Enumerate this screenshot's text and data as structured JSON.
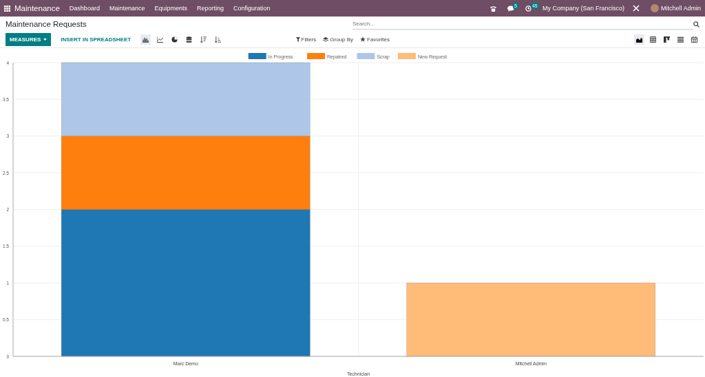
{
  "navbar": {
    "app_name": "Maintenance",
    "menu": [
      "Dashboard",
      "Maintenance",
      "Equipments",
      "Reporting",
      "Configuration"
    ],
    "messages_badge": "5",
    "activities_badge": "45",
    "company": "My Company (San Francisco)",
    "user": "Mitchell Admin"
  },
  "control_panel": {
    "title": "Maintenance Requests",
    "measures_button": "MEASURES",
    "insert_button": "INSERT IN SPREADSHEET",
    "search": {
      "placeholder": "Search..."
    },
    "filters": "Filters",
    "group_by": "Group By",
    "favorites": "Favorites",
    "chart_types": [
      {
        "kind": "bar",
        "selected": true
      },
      {
        "kind": "line",
        "selected": false
      },
      {
        "kind": "pie",
        "selected": false
      }
    ],
    "views": [
      {
        "kind": "graph",
        "selected": true
      },
      {
        "kind": "pivot",
        "selected": false
      },
      {
        "kind": "kanban",
        "selected": false
      },
      {
        "kind": "list",
        "selected": false
      },
      {
        "kind": "calendar",
        "selected": false
      }
    ]
  },
  "chart_data": {
    "type": "bar",
    "stacked": true,
    "grid": true,
    "legend": "top",
    "xlabel": "Technician",
    "categories": [
      "Marc Demo",
      "Mitchell Admin"
    ],
    "ylim": [
      0,
      4
    ],
    "yticks": [
      0,
      0.5,
      1,
      1.5,
      2,
      2.5,
      3,
      3.5,
      4
    ],
    "series": [
      {
        "name": "In Progress",
        "color": "#1f77b4",
        "values": [
          2,
          0
        ]
      },
      {
        "name": "Repaired",
        "color": "#ff7f0e",
        "values": [
          1,
          0
        ]
      },
      {
        "name": "Scrap",
        "color": "#aec7e8",
        "values": [
          1,
          0
        ]
      },
      {
        "name": "New Request",
        "color": "#ffbb78",
        "values": [
          0,
          1
        ]
      }
    ]
  }
}
